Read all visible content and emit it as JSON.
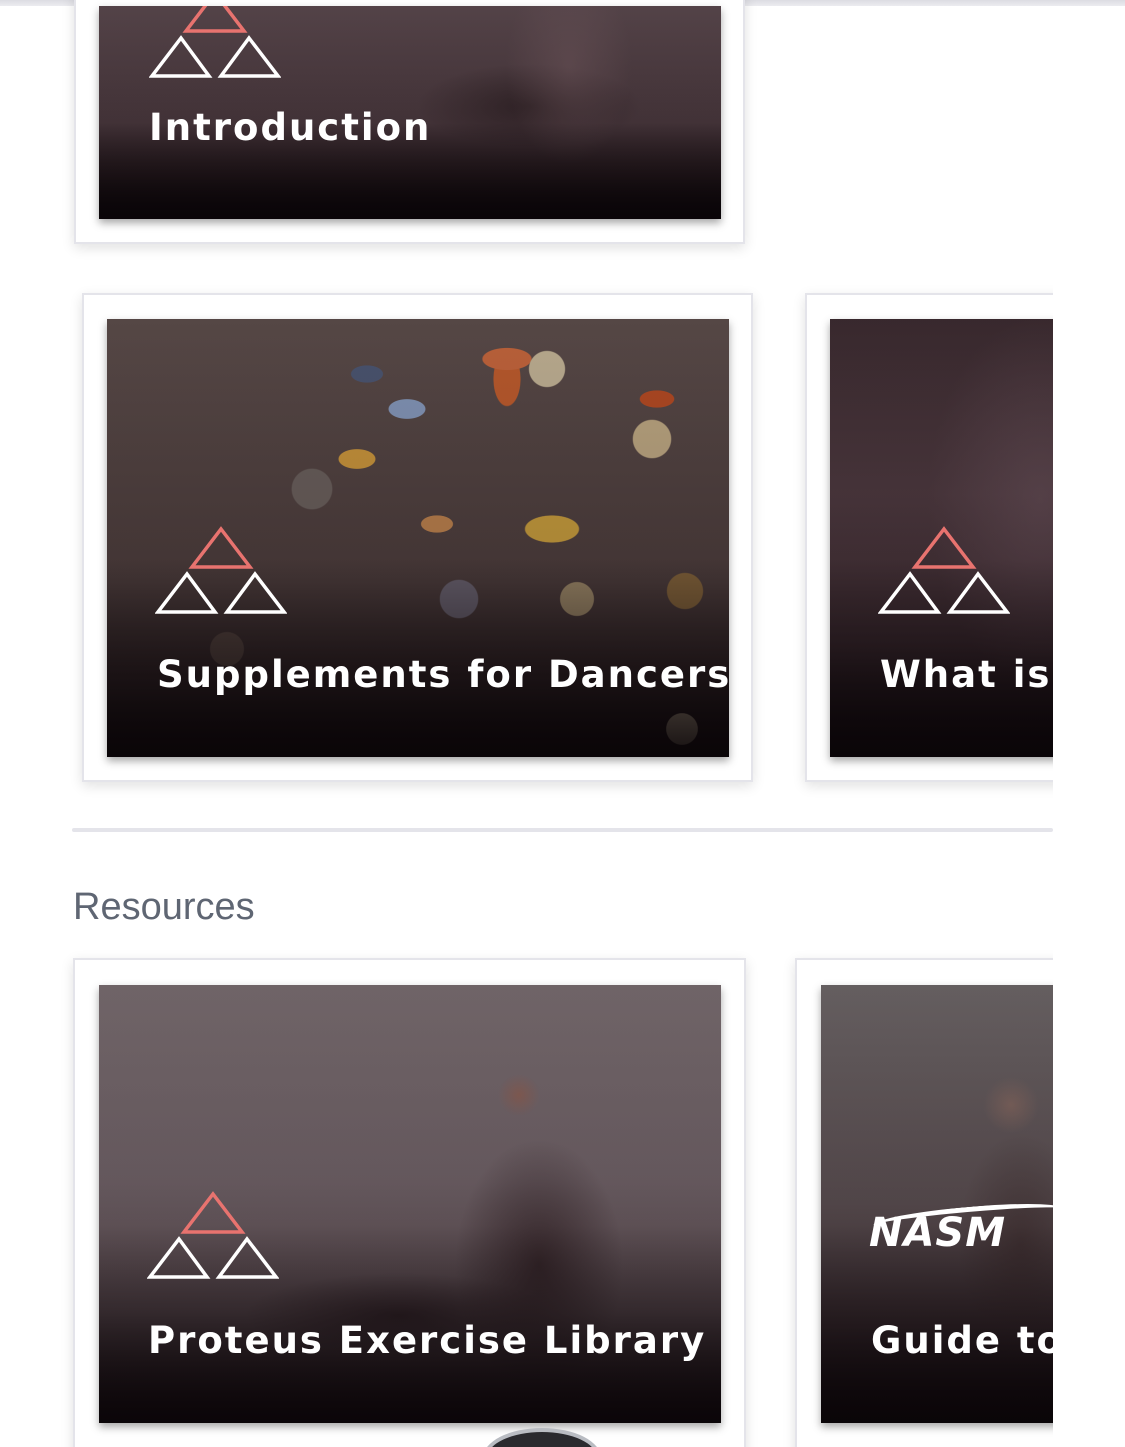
{
  "courses": {
    "intro_card": {
      "title": "Introduction"
    },
    "row": [
      {
        "title": "Supplements for Dancers"
      },
      {
        "title": "What is y"
      }
    ]
  },
  "resources": {
    "section_title": "Resources",
    "cards": [
      {
        "title": "Proteus Exercise Library"
      },
      {
        "title": "Guide to",
        "logo_text": "NASM"
      }
    ]
  },
  "colors": {
    "logo_top_triangle": "#e8736f",
    "logo_bottom_triangles": "#ffffff",
    "section_title": "#5f6673"
  },
  "icons": [
    "triangle-logo-icon"
  ]
}
